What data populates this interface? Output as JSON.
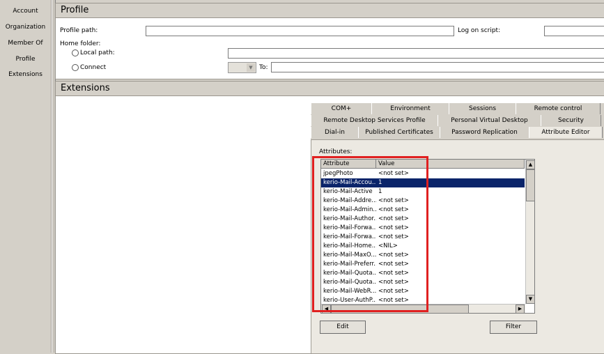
{
  "sidebar": {
    "items": [
      {
        "label": "Account"
      },
      {
        "label": "Organization"
      },
      {
        "label": "Member Of"
      },
      {
        "label": "Profile"
      },
      {
        "label": "Extensions"
      }
    ]
  },
  "profile": {
    "title": "Profile",
    "profile_path_label": "Profile path:",
    "profile_path_value": "",
    "logon_script_label": "Log on script:",
    "logon_script_value": "",
    "home_folder_label": "Home folder:",
    "local_path_label": "Local path:",
    "local_path_value": "",
    "connect_label": "Connect",
    "to_label": "To:",
    "to_value": ""
  },
  "extensions": {
    "title": "Extensions",
    "tabs_row1": [
      {
        "label": "COM+"
      },
      {
        "label": "Environment"
      },
      {
        "label": "Sessions"
      },
      {
        "label": "Remote control"
      }
    ],
    "tabs_row2": [
      {
        "label": "Remote Desktop Services Profile"
      },
      {
        "label": "Personal Virtual Desktop"
      },
      {
        "label": "Security"
      }
    ],
    "tabs_row3": [
      {
        "label": "Dial-in"
      },
      {
        "label": "Published Certificates"
      },
      {
        "label": "Password Replication"
      },
      {
        "label": "Attribute Editor"
      }
    ],
    "active_tab": "Attribute Editor",
    "attributes_label": "Attributes:",
    "columns": {
      "attribute": "Attribute",
      "value": "Value"
    },
    "rows": [
      {
        "attribute": "jpegPhoto",
        "value": "<not set>"
      },
      {
        "attribute": "kerio-Mail-Accou...",
        "value": "1"
      },
      {
        "attribute": "kerio-Mail-Active",
        "value": "1"
      },
      {
        "attribute": "kerio-Mail-Addre...",
        "value": "<not set>"
      },
      {
        "attribute": "kerio-Mail-Admin...",
        "value": "<not set>"
      },
      {
        "attribute": "kerio-Mail-Author...",
        "value": "<not set>"
      },
      {
        "attribute": "kerio-Mail-Forwa...",
        "value": "<not set>"
      },
      {
        "attribute": "kerio-Mail-Forwa...",
        "value": "<not set>"
      },
      {
        "attribute": "kerio-Mail-Home...",
        "value": "<NIL>"
      },
      {
        "attribute": "kerio-Mail-MaxO...",
        "value": "<not set>"
      },
      {
        "attribute": "kerio-Mail-Preferr...",
        "value": "<not set>"
      },
      {
        "attribute": "kerio-Mail-Quota...",
        "value": "<not set>"
      },
      {
        "attribute": "kerio-Mail-Quota...",
        "value": "<not set>"
      },
      {
        "attribute": "kerio-Mail-WebR...",
        "value": "<not set>"
      },
      {
        "attribute": "kerio-User-AuthP...",
        "value": "<not set>"
      }
    ],
    "selected_row": 1,
    "edit_button": "Edit",
    "filter_button": "Filter"
  },
  "colors": {
    "highlight": "#0a246a",
    "annotation_red": "#e02020"
  },
  "icons": {
    "radio": "radio-icon",
    "dropdown": "chevron-down-icon",
    "scroll_up": "arrow-up-icon",
    "scroll_down": "arrow-down-icon",
    "scroll_left": "arrow-left-icon",
    "scroll_right": "arrow-right-icon"
  }
}
